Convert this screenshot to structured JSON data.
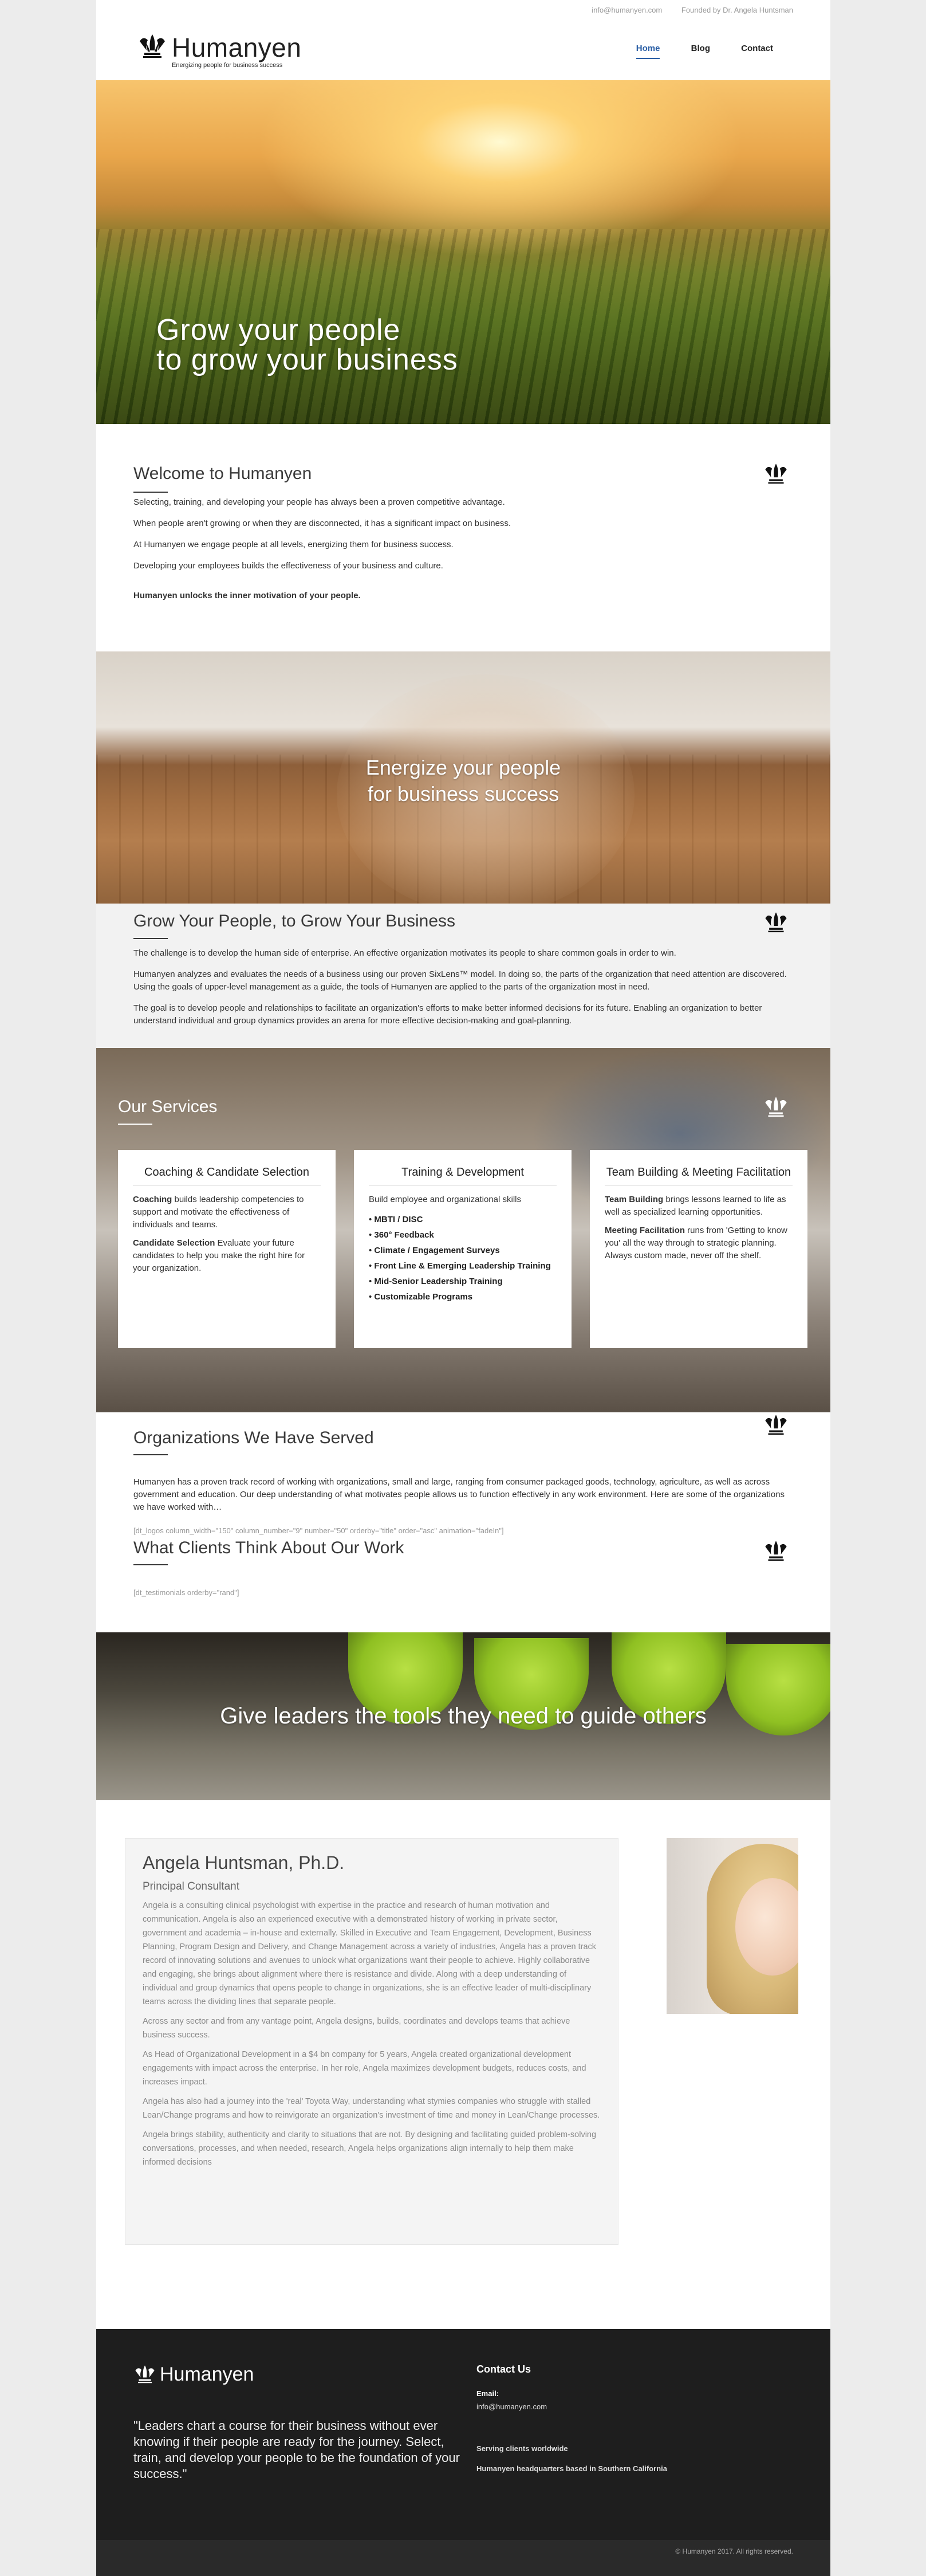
{
  "topbar": {
    "email": "info@humanyen.com",
    "founded": "Founded by Dr. Angela Huntsman"
  },
  "header": {
    "brand": "Humanyen",
    "tagline": "Energizing people for business success",
    "nav": [
      "Home",
      "Blog",
      "Contact"
    ]
  },
  "hero": {
    "line1": "Grow your people",
    "line2": "to grow your business"
  },
  "welcome": {
    "title": "Welcome to Humanyen",
    "paragraphs": [
      "Selecting, training, and developing your people has always been a proven competitive advantage.",
      "When people aren't growing or when they are disconnected, it has a significant impact on business.",
      "At Humanyen we engage people at all levels, energizing them for business success.",
      "Developing your employees builds the effectiveness of your business and culture."
    ],
    "bold": "Humanyen unlocks the inner motivation of your people."
  },
  "energize": {
    "line1": "Energize your people",
    "line2": "for business success"
  },
  "grow": {
    "title": "Grow Your People, to Grow Your Business",
    "paragraphs": [
      "The challenge is to develop the human side of enterprise. An effective organization motivates its people to share common goals in order to win.",
      "Humanyen analyzes and evaluates the needs of a business using our proven SixLens™ model.  In doing so, the parts of the organization that need attention are discovered.  Using the goals of upper-level management as a guide, the tools of Humanyen are applied to the parts of the organization most in need.",
      "The goal is to develop people and relationships to facilitate an organization's efforts to make better informed decisions for its future.  Enabling an organization to better understand individual and group dynamics provides an arena for more effective decision-making and goal-planning."
    ]
  },
  "services": {
    "title": "Our Services",
    "card1": {
      "title": "Coaching & Candidate Selection",
      "p1_bold": "Coaching",
      "p1_rest": " builds leadership competencies to support and motivate the effectiveness of individuals and teams.",
      "p2_bold": "Candidate Selection",
      "p2_rest": "  Evaluate your future candidates to help you make the right hire for your organization."
    },
    "card2": {
      "title": "Training & Development",
      "intro": "Build employee and organizational skills",
      "items": [
        "MBTI / DISC",
        "360° Feedback",
        "Climate / Engagement Surveys",
        "Front Line & Emerging Leadership Training",
        "Mid-Senior Leadership Training",
        "Customizable Programs"
      ]
    },
    "card3": {
      "title": "Team Building & Meeting Facilitation",
      "p1_bold": "Team Building",
      "p1_rest": " brings lessons learned to life as well as specialized learning opportunities.",
      "p2_bold": "Meeting Facilitation",
      "p2_rest": " runs from 'Getting to know you' all the way through to strategic planning. Always custom made, never off the shelf."
    }
  },
  "organizations": {
    "title": "Organizations We Have Served",
    "text": "Humanyen has a proven track record of working with organizations, small and large, ranging from consumer packaged goods, technology, agriculture, as well as across government and education. Our deep understanding of what motivates people allows us to function effectively in any work environment. Here are some of the organizations we have worked with…",
    "shortcode": "[dt_logos column_width=\"150\" column_number=\"9\" number=\"50\" orderby=\"title\" order=\"asc\" animation=\"fadeIn\"]"
  },
  "clients": {
    "title": "What Clients Think About Our Work",
    "shortcode": "[dt_testimonials orderby=\"rand\"]"
  },
  "leaders": {
    "title": "Give leaders the tools they need to guide others"
  },
  "bio": {
    "name": "Angela Huntsman, Ph.D.",
    "role": "Principal Consultant",
    "paragraphs": [
      "Angela is a consulting clinical psychologist with expertise in the practice and research of human motivation and communication. Angela is also an experienced executive with a demonstrated history of working in private sector, government and academia – in-house and externally. Skilled in Executive and Team Engagement, Development, Business Planning, Program Design and Delivery, and Change Management across a variety of industries, Angela has a proven track record of innovating solutions and avenues to unlock what organizations want their people to achieve. Highly collaborative and engaging, she brings about alignment where there is resistance and divide. Along with a deep understanding of individual and group dynamics that opens people to change in organizations, she is an effective leader of multi-disciplinary teams across the dividing lines that separate people.",
      "Across any sector and from any vantage point, Angela designs, builds, coordinates and develops teams that achieve business success.",
      "As Head of Organizational Development in a $4 bn company for 5 years, Angela created organizational development engagements with impact across the enterprise. In her role, Angela maximizes development budgets, reduces costs, and increases impact.",
      "Angela has also had a journey into the 'real' Toyota Way, understanding what stymies companies who struggle with stalled Lean/Change programs and how to reinvigorate an organization's investment of time and money in Lean/Change processes.",
      "Angela brings stability, authenticity and clarity to situations that are not. By designing and facilitating guided problem-solving conversations, processes, and when needed, research, Angela helps organizations align internally to help them make informed decisions"
    ]
  },
  "footer": {
    "brand": "Humanyen",
    "quote": "\"Leaders chart a course for their business without ever knowing if their people are ready for the journey. Select, train, and develop your people to be the foundation of your success.\"",
    "contact_title": "Contact Us",
    "email_label": "Email:",
    "email": "info@humanyen.com",
    "serving": "Serving clients worldwide",
    "hq": "Humanyen headquarters based in Southern California",
    "copyright": "© Humanyen 2017. All rights reserved."
  },
  "icons": {
    "crown": "crown-logo-icon"
  },
  "colors": {
    "nav_active": "#2b5fa6",
    "footer_bg": "#1e1e1e"
  }
}
